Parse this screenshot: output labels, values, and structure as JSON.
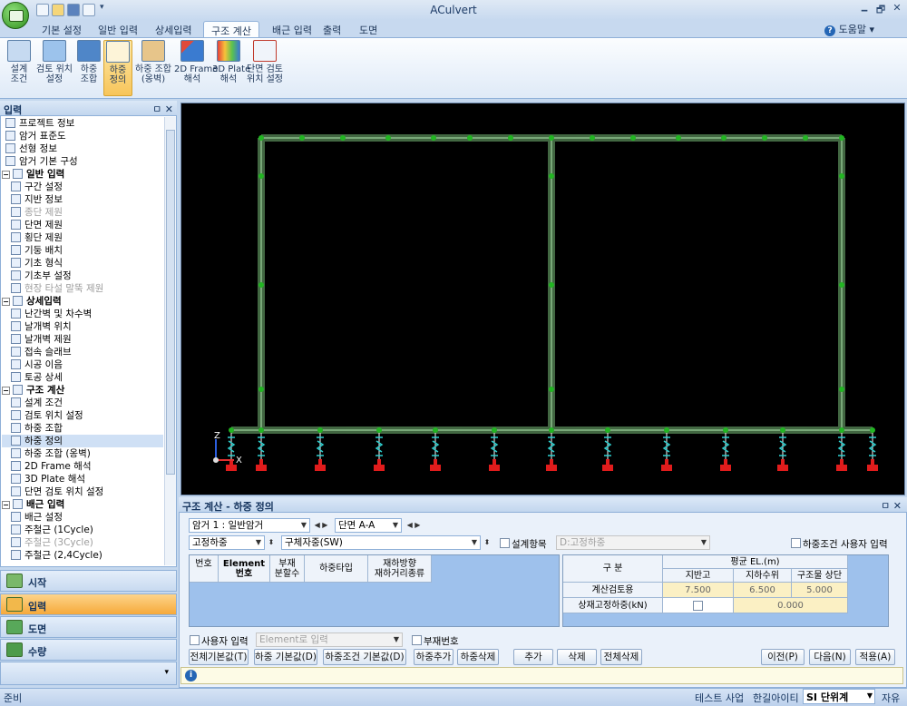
{
  "window": {
    "title": "ACulvert",
    "min": "🗕",
    "max": "🗗",
    "close": "✕"
  },
  "ribbon_tabs": [
    "기본 설정",
    "일반 입력",
    "상세입력",
    "구조 계산",
    "배근 입력",
    "출력",
    "도면"
  ],
  "help": "도움말",
  "ribbon_buttons": [
    {
      "label": "설계\n조건",
      "icon": "design-condition-icon"
    },
    {
      "label": "검토 위치\n설정",
      "icon": "check-position-icon"
    },
    {
      "label": "하중\n조합",
      "icon": "load-combination-icon"
    },
    {
      "label": "하중\n정의",
      "icon": "load-definition-icon"
    },
    {
      "label": "하중 조합\n(옹벽)",
      "icon": "retaining-wall-icon"
    },
    {
      "label": "2D Frame\n해석",
      "icon": "frame-2d-icon"
    },
    {
      "label": "3D Plate\n해석",
      "icon": "plate-3d-icon"
    },
    {
      "label": "단면 검토\n위치 설정",
      "icon": "section-check-icon"
    }
  ],
  "left_panel": {
    "title": "입력",
    "pin": "ㅁ ✕",
    "tree": [
      {
        "label": "프로젝트 정보",
        "type": "item"
      },
      {
        "label": "암거 표준도",
        "type": "item"
      },
      {
        "label": "선형 정보",
        "type": "item"
      },
      {
        "label": "암거 기본 구성",
        "type": "item"
      },
      {
        "label": "일반 입력",
        "type": "group"
      },
      {
        "label": "구간 설정",
        "type": "item"
      },
      {
        "label": "지반 정보",
        "type": "item"
      },
      {
        "label": "종단 제원",
        "type": "disabled"
      },
      {
        "label": "단면 제원",
        "type": "item"
      },
      {
        "label": "횡단 제원",
        "type": "item"
      },
      {
        "label": "기둥 배치",
        "type": "item"
      },
      {
        "label": "기초 형식",
        "type": "item"
      },
      {
        "label": "기초부 설정",
        "type": "item"
      },
      {
        "label": "현장 타설 말뚝 제원",
        "type": "disabled"
      },
      {
        "label": "상세입력",
        "type": "group"
      },
      {
        "label": "난간벽 및 차수벽",
        "type": "item"
      },
      {
        "label": "날개벽 위치",
        "type": "item"
      },
      {
        "label": "날개벽 제원",
        "type": "item"
      },
      {
        "label": "접속 슬래브",
        "type": "item"
      },
      {
        "label": "시공 이음",
        "type": "item"
      },
      {
        "label": "토공 상세",
        "type": "item"
      },
      {
        "label": "구조 계산",
        "type": "group"
      },
      {
        "label": "설계 조건",
        "type": "item"
      },
      {
        "label": "검토 위치 설정",
        "type": "item"
      },
      {
        "label": "하중 조합",
        "type": "item"
      },
      {
        "label": "하중 정의",
        "type": "selected"
      },
      {
        "label": "하중 조합 (옹벽)",
        "type": "item"
      },
      {
        "label": "2D Frame 해석",
        "type": "item"
      },
      {
        "label": "3D Plate 해석",
        "type": "item"
      },
      {
        "label": "단면 검토 위치 설정",
        "type": "item"
      },
      {
        "label": "배근 입력",
        "type": "group"
      },
      {
        "label": "배근 설정",
        "type": "item"
      },
      {
        "label": "주철근 (1Cycle)",
        "type": "item"
      },
      {
        "label": "주철근 (3Cycle)",
        "type": "disabled"
      },
      {
        "label": "주철근 (2,4Cycle)",
        "type": "item"
      }
    ],
    "nav": [
      "시작",
      "입력",
      "도면",
      "수량"
    ]
  },
  "bottom_panel": {
    "title": "구조 계산 - 하중 정의",
    "pin": "ㅁ ✕",
    "culvert_combo": "암거 1 : 일반암거",
    "section_combo": "단면 A-A",
    "load_type_combo": "고정하중",
    "load_name_combo": "구체자중(SW)",
    "design_item_label": "설계항목",
    "design_item_combo": "D:고정하중",
    "user_load_condition": "하중조건 사용자 입력",
    "grid_left_headers": [
      "번호",
      "Element\n번호",
      "부재\n분할수",
      "하중타입",
      "재하방향\n재하거리종류"
    ],
    "grid_right": {
      "col_title": "구 분",
      "group_title": "평균 EL.(m)",
      "cols": [
        "지반고",
        "지하수위",
        "구조물 상단"
      ],
      "row1_label": "계산검토용",
      "row1_values": [
        "7.500",
        "6.500",
        "5.000"
      ],
      "row2_label": "상재고정하중(kN)",
      "row2_value": "0.000"
    },
    "user_input_label": "사용자 입력",
    "element_combo": "Element로 입력",
    "member_no_label": "부재번호",
    "buttons": [
      "전체기본값(T)",
      "하중 기본값(D)",
      "하중조건 기본값(D)",
      "하중추가",
      "하중삭제",
      "추가",
      "삭제",
      "전체삭제",
      "이전(P)",
      "다음(N)",
      "적용(A)"
    ]
  },
  "status": {
    "left": "준비",
    "company1": "테스트 사업",
    "company2": "한길아이티",
    "unit": "SI 단위계",
    "mode": "자유"
  }
}
